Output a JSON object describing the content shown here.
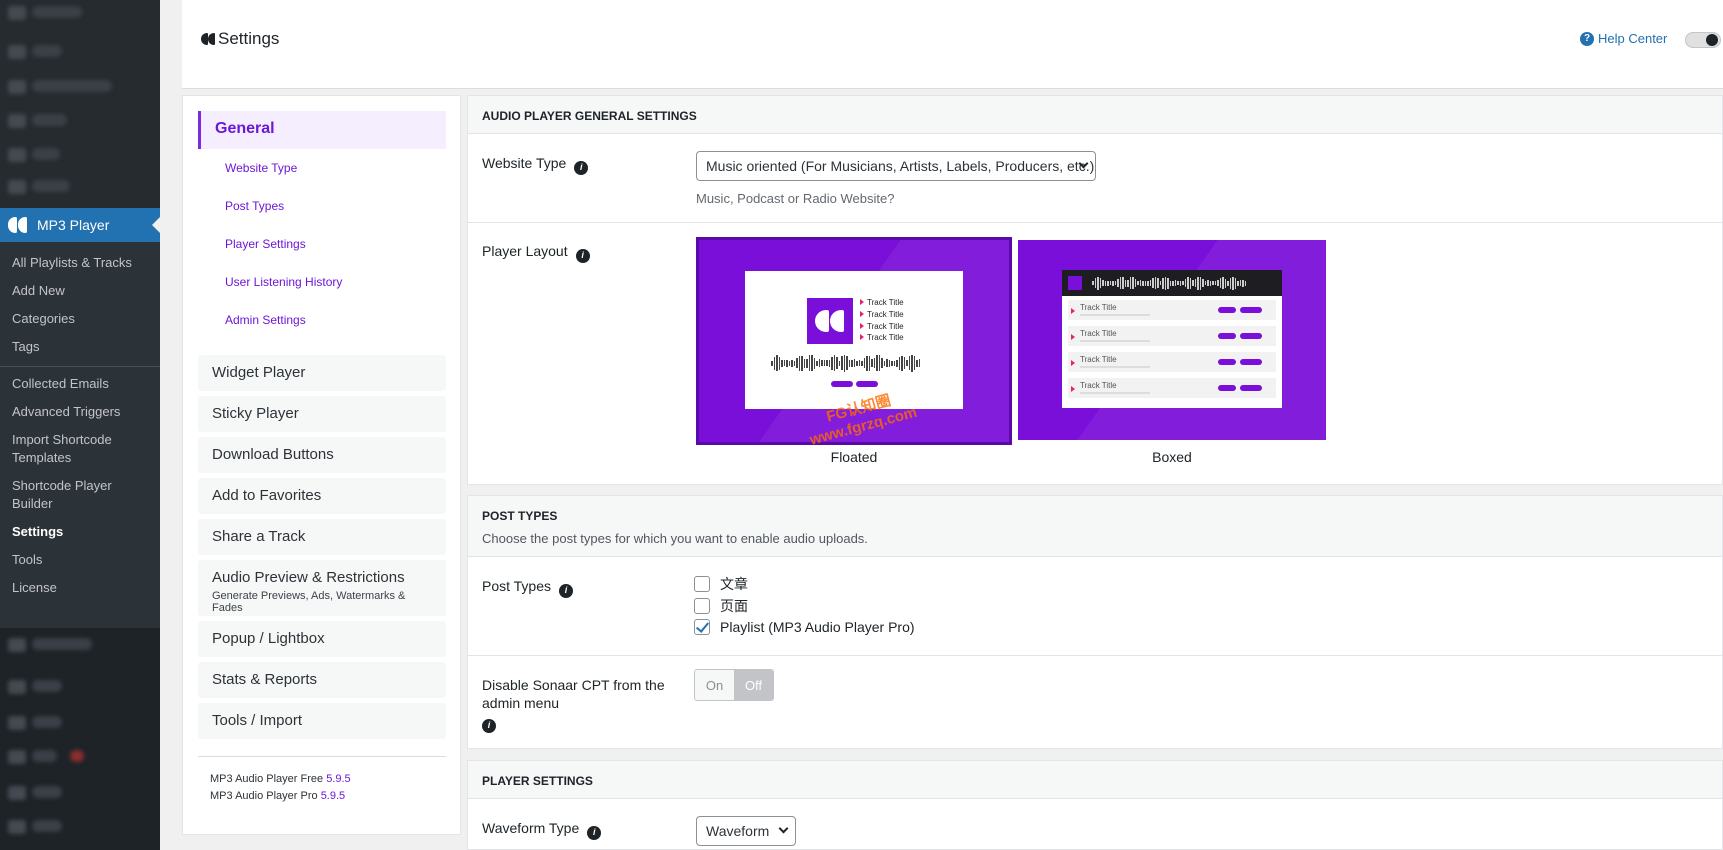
{
  "admin_menu": {
    "plugin_label": "MP3 Player",
    "submenu": [
      {
        "label": "All Playlists & Tracks",
        "current": false
      },
      {
        "label": "Add New",
        "current": false
      },
      {
        "label": "Categories",
        "current": false
      },
      {
        "label": "Tags",
        "current": false
      },
      {
        "label": "Collected Emails",
        "current": false
      },
      {
        "label": "Advanced Triggers",
        "current": false
      },
      {
        "label": "Import Shortcode Templates",
        "current": false
      },
      {
        "label": "Shortcode Player Builder",
        "current": false
      },
      {
        "label": "Settings",
        "current": true
      },
      {
        "label": "Tools",
        "current": false
      },
      {
        "label": "License",
        "current": false
      }
    ]
  },
  "header": {
    "title": "Settings",
    "help_label": "Help Center",
    "help_icon": "question-circle-icon",
    "dark_mode_icon": "moon-icon"
  },
  "settings_nav": {
    "active": "General",
    "general_sub": [
      "Website Type",
      "Post Types",
      "Player Settings",
      "User Listening History",
      "Admin Settings"
    ],
    "items": [
      {
        "label": "Widget Player",
        "desc": ""
      },
      {
        "label": "Sticky Player",
        "desc": ""
      },
      {
        "label": "Download Buttons",
        "desc": ""
      },
      {
        "label": "Add to Favorites",
        "desc": ""
      },
      {
        "label": "Share a Track",
        "desc": ""
      },
      {
        "label": "Audio Preview & Restrictions",
        "desc": "Generate Previews, Ads, Watermarks & Fades"
      },
      {
        "label": "Popup / Lightbox",
        "desc": ""
      },
      {
        "label": "Stats & Reports",
        "desc": ""
      },
      {
        "label": "Tools / Import",
        "desc": ""
      }
    ],
    "versions": [
      {
        "label": "MP3 Audio Player Free",
        "version": "5.9.5"
      },
      {
        "label": "MP3 Audio Player Pro",
        "version": "5.9.5"
      }
    ]
  },
  "general_panel": {
    "heading": "Audio Player General Settings",
    "website_type": {
      "label": "Website Type",
      "value": "Music oriented (For Musicians, Artists, Labels, Producers, etc.)",
      "hint": "Music, Podcast or Radio Website?"
    },
    "player_layout": {
      "label": "Player Layout",
      "options": [
        {
          "caption": "Floated",
          "selected": true
        },
        {
          "caption": "Boxed",
          "selected": false
        }
      ],
      "preview_track_label": "Track Title"
    }
  },
  "post_types_panel": {
    "heading": "Post Types",
    "description": "Choose the post types for which you want to enable audio uploads.",
    "label": "Post Types",
    "options": [
      {
        "label": "文章",
        "checked": false
      },
      {
        "label": "页面",
        "checked": false
      },
      {
        "label": "Playlist (MP3 Audio Player Pro)",
        "checked": true
      }
    ],
    "disable_cpt": {
      "label": "Disable Sonaar CPT from the admin menu",
      "on_label": "On",
      "off_label": "Off",
      "value": "Off"
    }
  },
  "player_settings_panel": {
    "heading": "Player Settings",
    "waveform_type": {
      "label": "Waveform Type",
      "value": "Waveform"
    }
  },
  "watermark": {
    "line1": "FG认知圈",
    "line2": "www.fgrzq.com"
  },
  "colors": {
    "accent": "#7a0fd9",
    "wp_blue": "#2271b1",
    "sidebar": "#1d2327"
  }
}
